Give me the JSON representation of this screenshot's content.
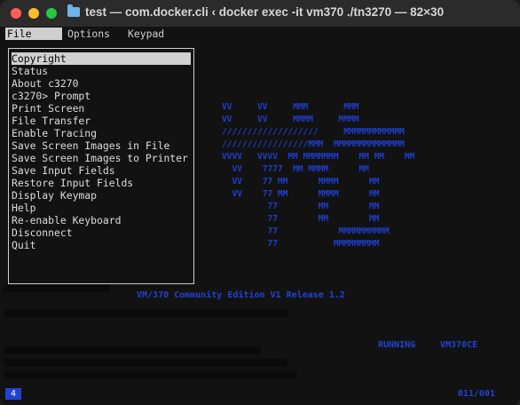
{
  "window": {
    "title": "test — com.docker.cli ‹ docker exec -it vm370 ./tn3270 — 82×30"
  },
  "menubar": {
    "file": "File",
    "options": "Options",
    "keypad": "Keypad"
  },
  "menu_items": [
    "Copyright",
    "Status",
    "About c3270",
    "c3270> Prompt",
    "Print Screen",
    "File Transfer",
    "Enable Tracing",
    "Save Screen Images in File",
    "Save Screen Images to Printer",
    "Save Input Fields",
    "Restore Input Fields",
    "Display Keymap",
    "Help",
    "Re-enable Keyboard",
    "Disconnect",
    "Quit"
  ],
  "selected_index": 0,
  "screen": {
    "banner_line": "VM/370 Community Edition V1 Release 1.2",
    "running": "RUNNING",
    "system": "VM370CE",
    "status_left": "4",
    "status_right": "011/001"
  },
  "colors": {
    "accent_blue": "#1f44d4",
    "menu_bg": "#d0d0d0"
  }
}
